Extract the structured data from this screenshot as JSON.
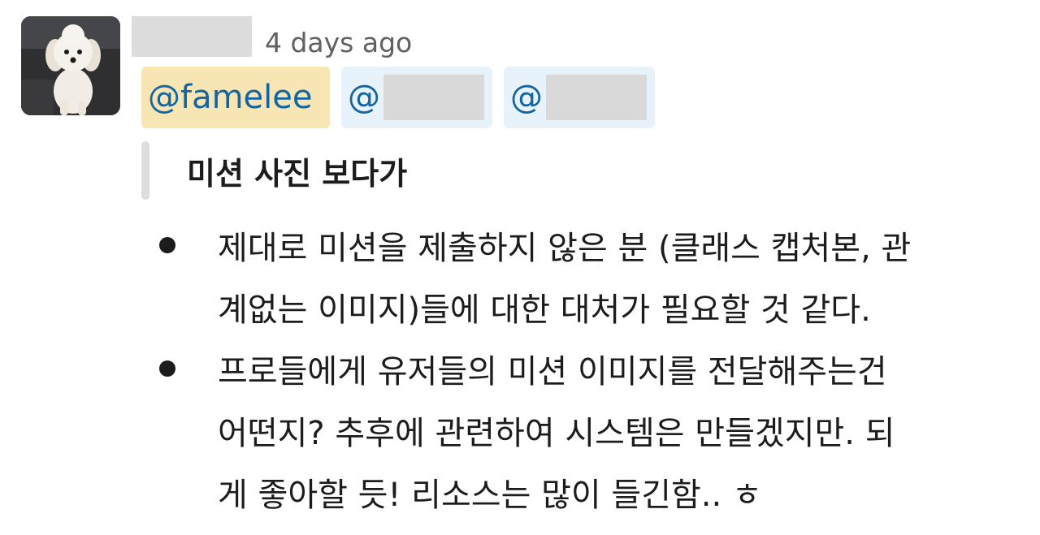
{
  "message": {
    "timestamp": "4 days ago",
    "mentions": [
      {
        "label": "@famelee",
        "self": true
      },
      {
        "label": "@",
        "self": false
      },
      {
        "label": "@",
        "self": false
      }
    ],
    "quote": "미션 사진 보다가",
    "bullets": [
      {
        "lines": [
          "제대로 미션을 제출하지 않은 분 (클래스 캡처본, 관",
          "계없는 이미지)들에 대한 대처가 필요할 것 같다."
        ]
      },
      {
        "lines": [
          "프로들에게 유저들의 미션 이미지를 전달해주는건",
          "어떤지? 추후에 관련하여 시스템은 만들겠지만. 되",
          "게 좋아할 듯! 리소스는 많이 들긴함.. ㅎ"
        ]
      }
    ]
  },
  "colors": {
    "mention_self_bg": "#f7e6b3",
    "mention_other_bg": "#e8f2fb",
    "mention_text": "#1264a3",
    "timestamp": "#616061",
    "quote_bar": "#dddddd"
  },
  "icons": {
    "avatar": "dog-avatar"
  }
}
